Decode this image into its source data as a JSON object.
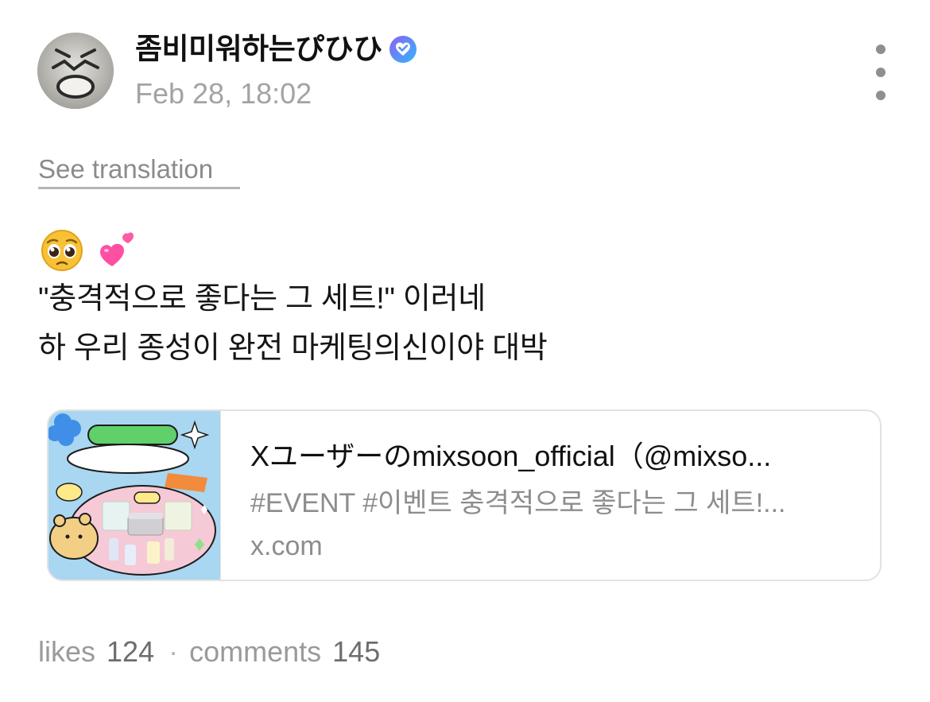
{
  "post": {
    "author": {
      "name": "좀비미워하는ぴひひ",
      "avatar_icon": "avatar-image",
      "verified_icon": "verified-badge-icon"
    },
    "timestamp": "Feb 28, 18:02",
    "more_icon": "more-vertical-icon",
    "see_translation": "See translation",
    "emojis": [
      "pleading-face",
      "two-hearts"
    ],
    "body_lines": [
      "\"충격적으로 좋다는 그 세트!\" 이러네",
      "하 우리 종성이 완전 마케팅의신이야 대박"
    ],
    "link_card": {
      "title": "Xユーザーのmixsoon_official（@mixso...",
      "description": "#EVENT #이벤트 충격적으로 좋다는 그 세트!...",
      "domain": "x.com",
      "thumbnail_icon": "event-thumbnail-image"
    },
    "stats": {
      "likes_label": "likes",
      "likes_count": "124",
      "separator": "·",
      "comments_label": "comments",
      "comments_count": "145"
    }
  },
  "colors": {
    "verified_gradient_start": "#7b6cf6",
    "verified_gradient_end": "#3fb6ff",
    "muted_text": "#9a9a9a",
    "thumb_bg": "#a9d6f0",
    "thumb_pink": "#f6c9d6"
  }
}
